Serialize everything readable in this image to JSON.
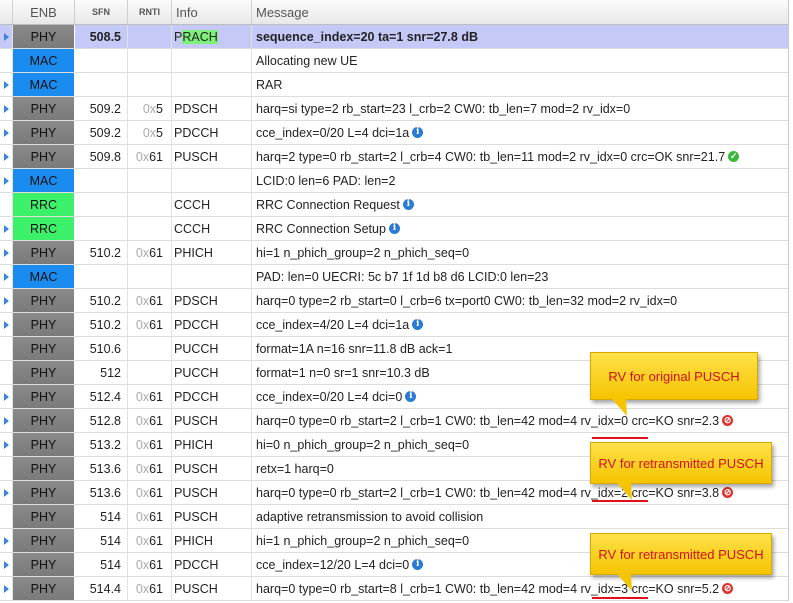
{
  "header": {
    "layer": "ENB",
    "sfn": "SFN",
    "rnti": "RNTI",
    "info": "Info",
    "message": "Message"
  },
  "rows": [
    {
      "arrow": true,
      "layer": "PHY",
      "sfn": "508.5",
      "rnti_prefix": "",
      "rnti": "",
      "info_a": "P",
      "info_b": "RACH",
      "message": "sequence_index=20 ta=1 snr=27.8 dB",
      "icon": "",
      "selected": true
    },
    {
      "arrow": false,
      "layer": "MAC",
      "sfn": "",
      "rnti_prefix": "",
      "rnti": "",
      "info_a": "",
      "info_b": "",
      "message": "Allocating new UE",
      "icon": ""
    },
    {
      "arrow": true,
      "layer": "MAC",
      "sfn": "",
      "rnti_prefix": "",
      "rnti": "",
      "info_a": "",
      "info_b": "",
      "message": "RAR",
      "icon": ""
    },
    {
      "arrow": true,
      "layer": "PHY",
      "sfn": "509.2",
      "rnti_prefix": "0x",
      "rnti": "5",
      "info_a": "PDSCH",
      "info_b": "",
      "message": "harq=si type=2 rb_start=23 l_crb=2 CW0: tb_len=7 mod=2 rv_idx=0",
      "icon": ""
    },
    {
      "arrow": true,
      "layer": "PHY",
      "sfn": "509.2",
      "rnti_prefix": "0x",
      "rnti": "5",
      "info_a": "PDCCH",
      "info_b": "",
      "message": "cce_index=0/20 L=4 dci=1a",
      "icon": "info-icon"
    },
    {
      "arrow": true,
      "layer": "PHY",
      "sfn": "509.8",
      "rnti_prefix": "0x",
      "rnti": "61",
      "info_a": "PUSCH",
      "info_b": "",
      "message": "harq=2 type=0 rb_start=2 l_crb=4 CW0: tb_len=11 mod=2 rv_idx=0 crc=OK snr=21.7",
      "icon": "ok-icon"
    },
    {
      "arrow": true,
      "layer": "MAC",
      "sfn": "",
      "rnti_prefix": "",
      "rnti": "",
      "info_a": "",
      "info_b": "",
      "message": "LCID:0 len=6 PAD: len=2",
      "icon": ""
    },
    {
      "arrow": false,
      "layer": "RRC",
      "sfn": "",
      "rnti_prefix": "",
      "rnti": "",
      "info_a": "CCCH",
      "info_b": "",
      "message": "RRC Connection Request",
      "icon": "info-icon"
    },
    {
      "arrow": true,
      "layer": "RRC",
      "sfn": "",
      "rnti_prefix": "",
      "rnti": "",
      "info_a": "CCCH",
      "info_b": "",
      "message": "RRC Connection Setup",
      "icon": "info-icon"
    },
    {
      "arrow": true,
      "layer": "PHY",
      "sfn": "510.2",
      "rnti_prefix": "0x",
      "rnti": "61",
      "info_a": "PHICH",
      "info_b": "",
      "message": "hi=1 n_phich_group=2 n_phich_seq=0",
      "icon": ""
    },
    {
      "arrow": true,
      "layer": "MAC",
      "sfn": "",
      "rnti_prefix": "",
      "rnti": "",
      "info_a": "",
      "info_b": "",
      "message": "PAD: len=0 UECRI: 5c b7 1f 1d b8 d6 LCID:0 len=23",
      "icon": ""
    },
    {
      "arrow": true,
      "layer": "PHY",
      "sfn": "510.2",
      "rnti_prefix": "0x",
      "rnti": "61",
      "info_a": "PDSCH",
      "info_b": "",
      "message": "harq=0 type=2 rb_start=0 l_crb=6 tx=port0 CW0: tb_len=32 mod=2 rv_idx=0",
      "icon": ""
    },
    {
      "arrow": true,
      "layer": "PHY",
      "sfn": "510.2",
      "rnti_prefix": "0x",
      "rnti": "61",
      "info_a": "PDCCH",
      "info_b": "",
      "message": "cce_index=4/20 L=4 dci=1a",
      "icon": "info-icon"
    },
    {
      "arrow": false,
      "layer": "PHY",
      "sfn": "510.6",
      "rnti_prefix": "",
      "rnti": "",
      "info_a": "PUCCH",
      "info_b": "",
      "message": "format=1A n=16 snr=11.8 dB ack=1",
      "icon": ""
    },
    {
      "arrow": false,
      "layer": "PHY",
      "sfn": "512",
      "rnti_prefix": "",
      "rnti": "",
      "info_a": "PUCCH",
      "info_b": "",
      "message": "format=1 n=0 sr=1 snr=10.3 dB",
      "icon": ""
    },
    {
      "arrow": true,
      "layer": "PHY",
      "sfn": "512.4",
      "rnti_prefix": "0x",
      "rnti": "61",
      "info_a": "PDCCH",
      "info_b": "",
      "message": "cce_index=0/20 L=4 dci=0",
      "icon": "info-icon"
    },
    {
      "arrow": true,
      "layer": "PHY",
      "sfn": "512.8",
      "rnti_prefix": "0x",
      "rnti": "61",
      "info_a": "PUSCH",
      "info_b": "",
      "message": "harq=0 type=0 rb_start=2 l_crb=1 CW0: tb_len=42 mod=4 rv_idx=0 crc=KO snr=2.3",
      "icon": "ko-icon"
    },
    {
      "arrow": true,
      "layer": "PHY",
      "sfn": "513.2",
      "rnti_prefix": "0x",
      "rnti": "61",
      "info_a": "PHICH",
      "info_b": "",
      "message": "hi=0 n_phich_group=2 n_phich_seq=0",
      "icon": ""
    },
    {
      "arrow": false,
      "layer": "PHY",
      "sfn": "513.6",
      "rnti_prefix": "0x",
      "rnti": "61",
      "info_a": "PUSCH",
      "info_b": "",
      "message": "retx=1 harq=0",
      "icon": ""
    },
    {
      "arrow": true,
      "layer": "PHY",
      "sfn": "513.6",
      "rnti_prefix": "0x",
      "rnti": "61",
      "info_a": "PUSCH",
      "info_b": "",
      "message": "harq=0 type=0 rb_start=2 l_crb=1 CW0: tb_len=42 mod=4 rv_idx=2 crc=KO snr=3.8",
      "icon": "ko-icon"
    },
    {
      "arrow": false,
      "layer": "PHY",
      "sfn": "514",
      "rnti_prefix": "0x",
      "rnti": "61",
      "info_a": "PUSCH",
      "info_b": "",
      "message": "adaptive retransmission to avoid collision",
      "icon": ""
    },
    {
      "arrow": true,
      "layer": "PHY",
      "sfn": "514",
      "rnti_prefix": "0x",
      "rnti": "61",
      "info_a": "PHICH",
      "info_b": "",
      "message": "hi=1 n_phich_group=2 n_phich_seq=0",
      "icon": ""
    },
    {
      "arrow": true,
      "layer": "PHY",
      "sfn": "514",
      "rnti_prefix": "0x",
      "rnti": "61",
      "info_a": "PDCCH",
      "info_b": "",
      "message": "cce_index=12/20 L=4 dci=0",
      "icon": "info-icon"
    },
    {
      "arrow": true,
      "layer": "PHY",
      "sfn": "514.4",
      "rnti_prefix": "0x",
      "rnti": "61",
      "info_a": "PUSCH",
      "info_b": "",
      "message": "harq=0 type=0 rb_start=8 l_crb=1 CW0: tb_len=42 mod=4 rv_idx=3 crc=KO snr=5.2",
      "icon": "ko-icon"
    }
  ],
  "annotations": {
    "note1": "RV for original PUSCH",
    "note2": "RV for retransmitted PUSCH",
    "note3": "RV for retransmitted PUSCH"
  },
  "colors": {
    "PHY": "#808080",
    "MAC": "#1a8cf0",
    "RRC": "#3cf06a",
    "selected": "#c5c9f7",
    "note": "#f5c400",
    "note_text": "#d1121b"
  }
}
